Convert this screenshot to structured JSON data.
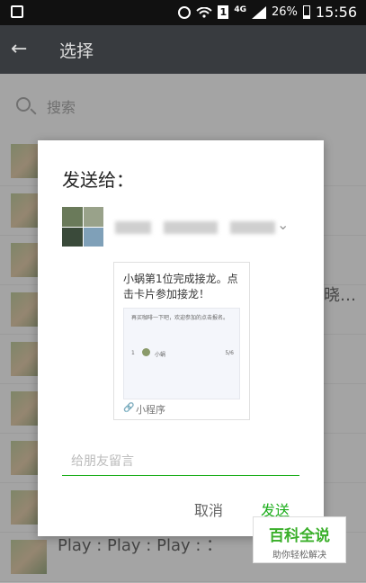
{
  "status_bar": {
    "network": "4G",
    "battery": "26%",
    "time": "15:56"
  },
  "header": {
    "title": "选择"
  },
  "search": {
    "placeholder": "搜索"
  },
  "background_list": {
    "items": [
      "",
      "",
      "",
      "",
      "",
      "",
      "",
      "",
      ""
    ],
    "partial_text_right": "晓…",
    "partial_text_bottom": "Play : Play : Play : ："
  },
  "dialog": {
    "heading": "发送给：",
    "card": {
      "title": "小蜗第1位完成接龙。点击卡片参加接龙！",
      "preview_text": "再买咖啡一下吧，欢迎参加的点击报名。",
      "preview_num": "1",
      "preview_name": "小蜗",
      "preview_date": "5/6",
      "mini_program_label": "小程序"
    },
    "message_placeholder": "给朋友留言",
    "cancel_label": "取消",
    "send_label": "发送"
  },
  "watermark": {
    "main": "百科全说",
    "sub": "助你轻松解决"
  },
  "colors": {
    "accent": "#1aad19",
    "topbar": "#383b3f"
  }
}
